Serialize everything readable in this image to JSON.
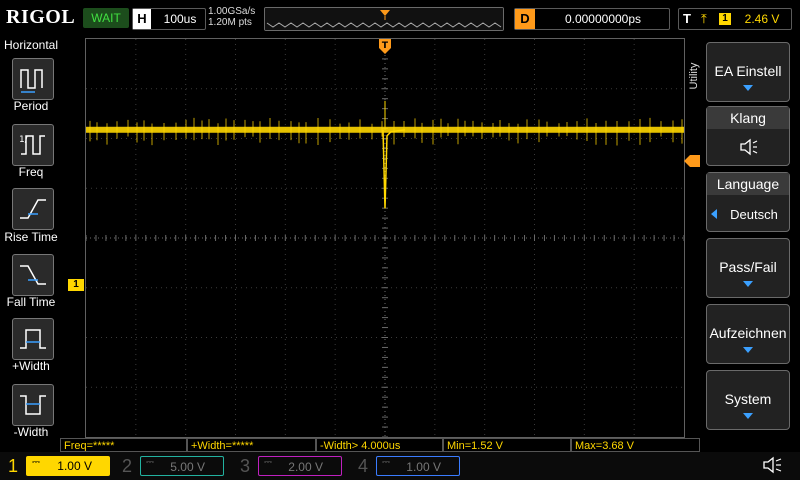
{
  "brand": "RIGOL",
  "colors": {
    "ch1": "#ffd700",
    "ch2": "#22b2a0",
    "ch3": "#c020c0",
    "ch4": "#3a7cff",
    "trigger": "#ff9a1a",
    "accent": "#3ba0ff"
  },
  "top_bar": {
    "run_status": "WAIT",
    "horizontal_key": "H",
    "timebase": "100us",
    "sample_rate": "1.00GSa/s",
    "memory_depth": "1.20M pts",
    "delay_key": "D",
    "delay_value": "0.00000000ps",
    "trigger_key": "T",
    "trigger_edge_icon": "rising-edge-icon",
    "trigger_source": "1",
    "trigger_level": "2.46 V"
  },
  "left_panel": {
    "title": "Horizontal",
    "items": [
      {
        "label": "Period",
        "icon": "period-icon"
      },
      {
        "label": "Freq",
        "icon": "freq-icon"
      },
      {
        "label": "Rise Time",
        "icon": "rise-time-icon"
      },
      {
        "label": "Fall Time",
        "icon": "fall-time-icon"
      },
      {
        "label": "+Width",
        "icon": "pos-width-icon"
      },
      {
        "label": "-Width",
        "icon": "neg-width-icon"
      }
    ]
  },
  "right_menu": {
    "tab_label": "Utility",
    "items": [
      {
        "label": "EA Einstell",
        "has_arrow": true
      },
      {
        "header": "Klang",
        "icon": "speaker-icon"
      },
      {
        "header": "Language",
        "value": "Deutsch"
      },
      {
        "label": "Pass/Fail",
        "has_arrow": true
      },
      {
        "label": "Aufzeichnen",
        "has_arrow": true
      },
      {
        "label": "System",
        "has_arrow": true
      }
    ]
  },
  "measurements": [
    "Freq=*****",
    "+Width=*****",
    "-Width> 4.000us",
    "Min=1.52 V",
    "Max=3.68 V"
  ],
  "channels": [
    {
      "num": "1",
      "scale": "1.00 V",
      "active": true
    },
    {
      "num": "2",
      "scale": "5.00 V",
      "active": false
    },
    {
      "num": "3",
      "scale": "2.00 V",
      "active": false
    },
    {
      "num": "4",
      "scale": "1.00 V",
      "active": false
    }
  ],
  "trace": {
    "channel": "1",
    "baseline_level_v": 3.1,
    "ground_marker_label": "1",
    "spike_min_v": 1.52,
    "spike_max_v": 3.68
  }
}
